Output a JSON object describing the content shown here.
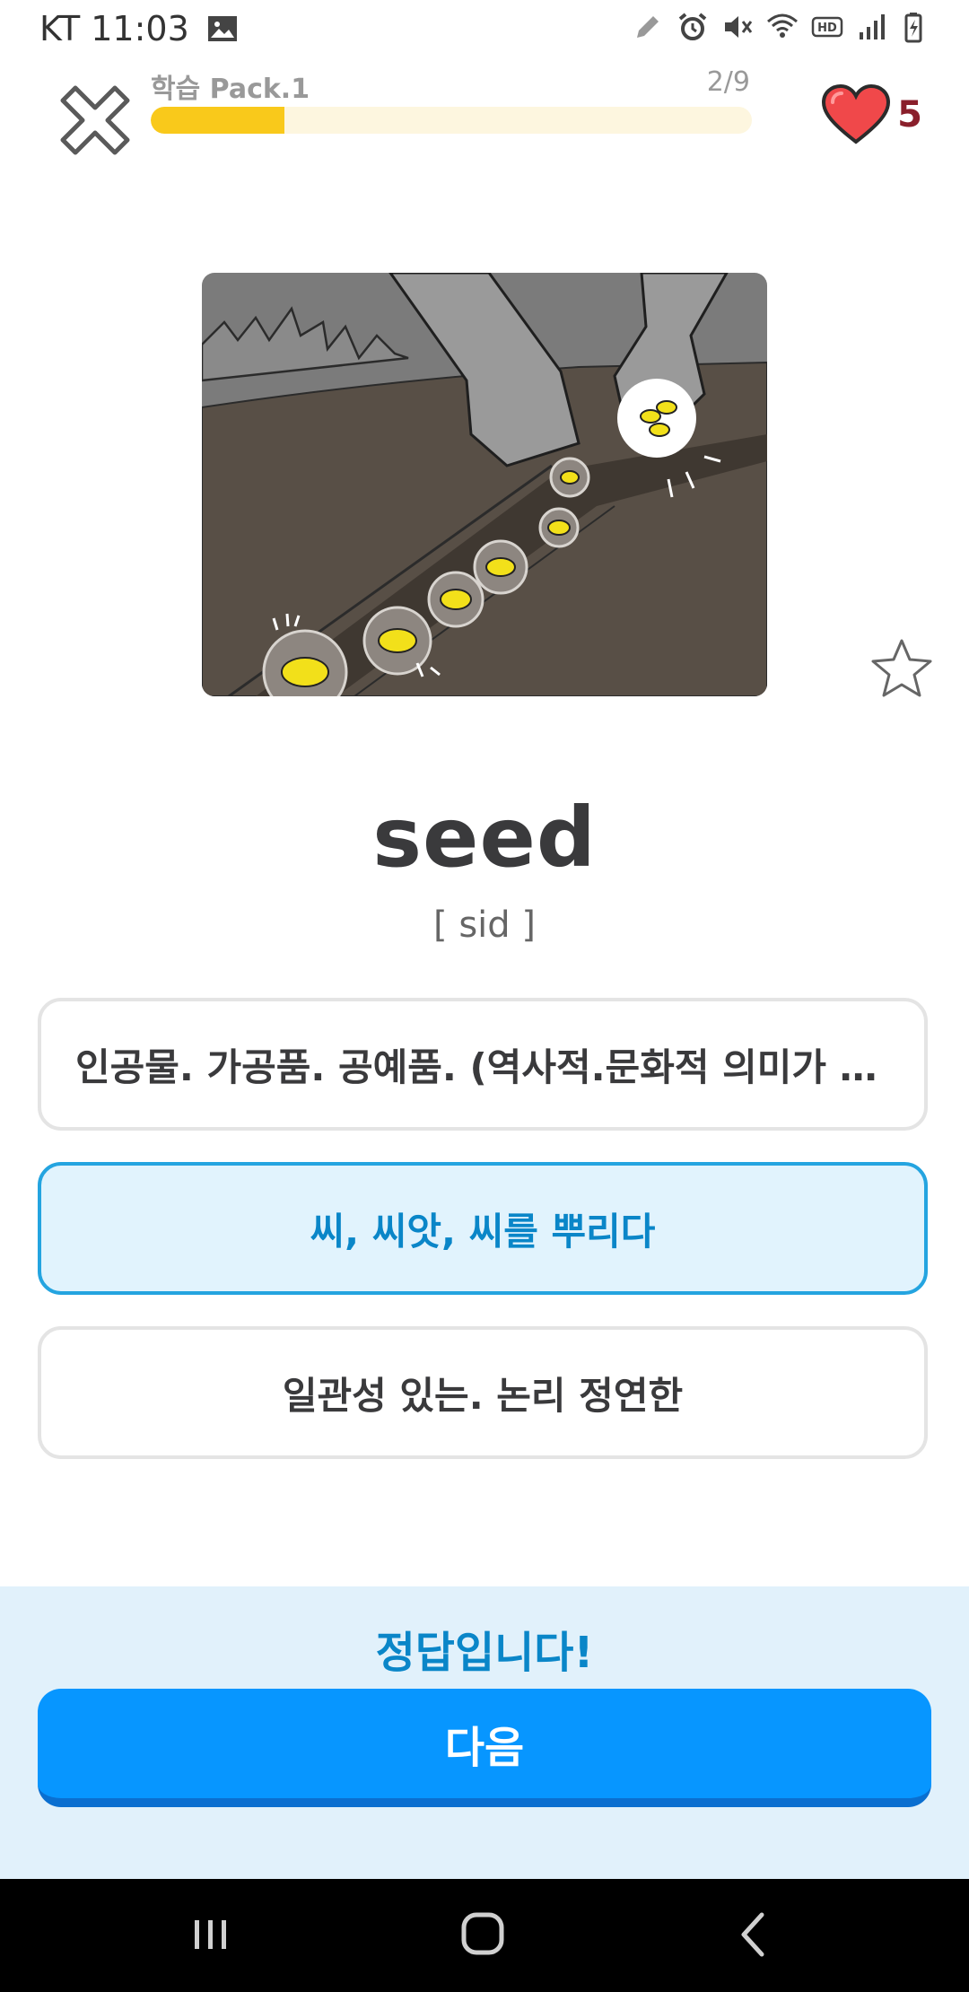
{
  "status": {
    "carrier_time": "KT 11:03"
  },
  "header": {
    "pack_label": "학습  Pack.1",
    "progress_text": "2/9",
    "progress_fraction": 0.222,
    "hearts": "5"
  },
  "card": {
    "word": "seed",
    "pronunciation": "[ sid ]"
  },
  "options": [
    {
      "text": "인공물. 가공품. 공예품. (역사적.문화적 의미가 있는 물건)"
    },
    {
      "text": "씨, 씨앗, 씨를 뿌리다"
    },
    {
      "text": "일관성 있는. 논리 정연한"
    }
  ],
  "feedback": {
    "message": "정답입니다!",
    "next_label": "다음"
  },
  "colors": {
    "accent": "#0796ff",
    "correct_text": "#0a86c8",
    "progress": "#f9c91b",
    "heart": "#f0484a"
  }
}
